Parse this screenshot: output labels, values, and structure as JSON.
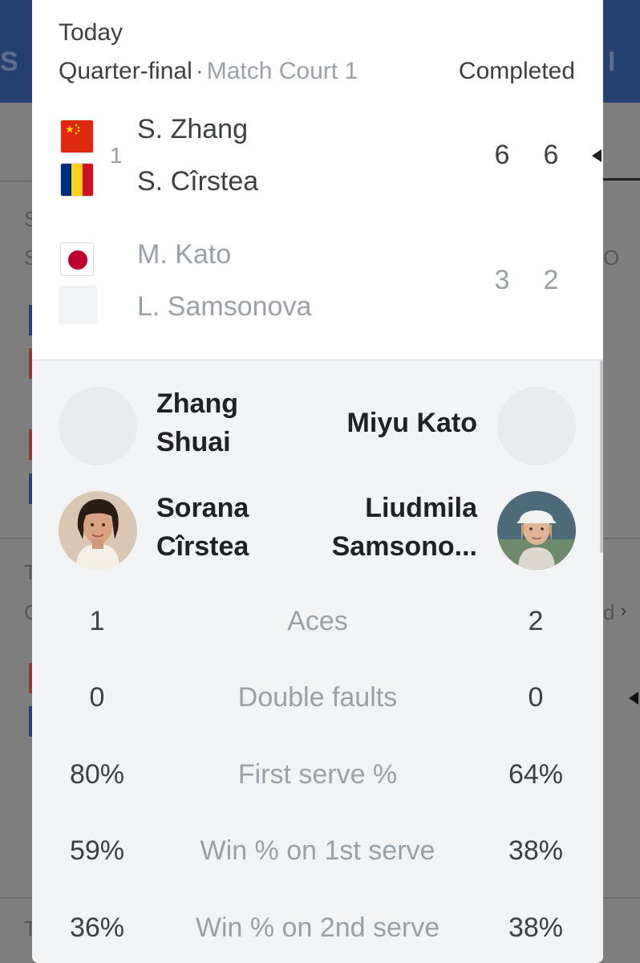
{
  "background": {
    "logo_left": "S M",
    "logo_right": "I",
    "letters": [
      "S",
      "S",
      "O",
      "T",
      "d",
      "C",
      "T"
    ]
  },
  "match": {
    "day": "Today",
    "round": "Quarter-final",
    "separator": "·",
    "court": "Match Court 1",
    "status": "Completed",
    "seed": "1",
    "team1": {
      "players": [
        "S. Zhang",
        "S. Cîrstea"
      ],
      "flags": [
        "china-flag-icon",
        "romania-flag-icon"
      ],
      "set_scores": [
        "6",
        "6"
      ],
      "winner": true
    },
    "team2": {
      "players": [
        "M. Kato",
        "L. Samsonova"
      ],
      "flags": [
        "japan-flag-icon",
        "blank-flag-icon"
      ],
      "set_scores": [
        "3",
        "2"
      ],
      "winner": false
    }
  },
  "players": {
    "left": [
      "Zhang Shuai",
      "Sorana Cîrstea"
    ],
    "right": [
      "Miyu Kato",
      "Liudmila Samsono..."
    ],
    "left_name_lines": [
      [
        "Zhang",
        "Shuai"
      ],
      [
        "Sorana",
        "Cîrstea"
      ]
    ],
    "right_name_lines": [
      [
        "Miyu Kato"
      ],
      [
        "Liudmila",
        "Samsono..."
      ]
    ]
  },
  "stats": [
    {
      "label": "Aces",
      "left": "1",
      "right": "2"
    },
    {
      "label": "Double faults",
      "left": "0",
      "right": "0"
    },
    {
      "label": "First serve %",
      "left": "80%",
      "right": "64%"
    },
    {
      "label": "Win % on 1st serve",
      "left": "59%",
      "right": "38%"
    },
    {
      "label": "Win % on 2nd serve",
      "left": "36%",
      "right": "38%"
    }
  ],
  "colors": {
    "header_bg": "#24406f",
    "china_red": "#de2910",
    "romania_blue": "#002b7f",
    "romania_yellow": "#fcd116",
    "romania_red": "#ce1126",
    "japan_red": "#bc002d"
  }
}
